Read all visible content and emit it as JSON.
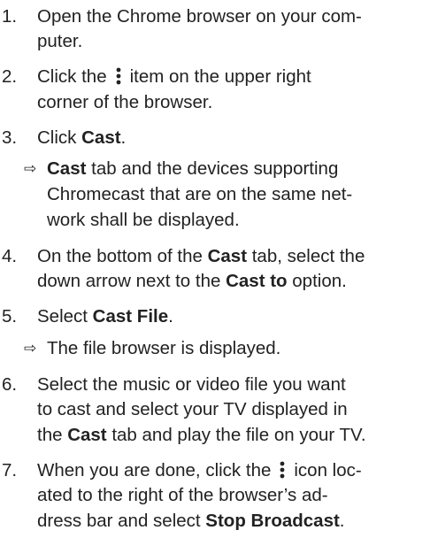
{
  "steps": [
    {
      "num": "1.",
      "lines": [
        "Open the Chrome browser on your com-",
        "puter."
      ]
    },
    {
      "num": "2.",
      "pre": "Click the",
      "icon": "kebab-menu-icon",
      "post": "item on the upper right",
      "line2": "corner of the browser."
    },
    {
      "num": "3.",
      "pre": "Click ",
      "bold": "Cast",
      "post": "."
    },
    {
      "result": true,
      "bold": "Cast",
      "rest1": " tab and the devices supporting",
      "line2": "Chromecast that are on the same net-",
      "line3": "work shall be displayed."
    },
    {
      "num": "4.",
      "l1_pre": "On the bottom of the ",
      "l1_bold": "Cast",
      "l1_post": " tab, select the",
      "l2_pre": "down arrow next to the ",
      "l2_bold": "Cast to",
      "l2_post": " option."
    },
    {
      "num": "5.",
      "pre": "Select ",
      "bold": "Cast File",
      "post": "."
    },
    {
      "result": true,
      "text": "The file browser is displayed."
    },
    {
      "num": "6.",
      "l1": "Select the music or video file you want",
      "l2": "to cast and select your TV displayed in",
      "l3_pre": "the ",
      "l3_bold": "Cast",
      "l3_post": " tab and play the file on your TV."
    },
    {
      "num": "7.",
      "pre": "When you are done, click the",
      "icon": "kebab-menu-icon",
      "post": "icon loc-",
      "l2": "ated to the right of the browser’s ad-",
      "l3_pre": "dress bar and select ",
      "l3_bold": "Stop Broadcast",
      "l3_post": "."
    }
  ],
  "result_arrow": "⇨"
}
